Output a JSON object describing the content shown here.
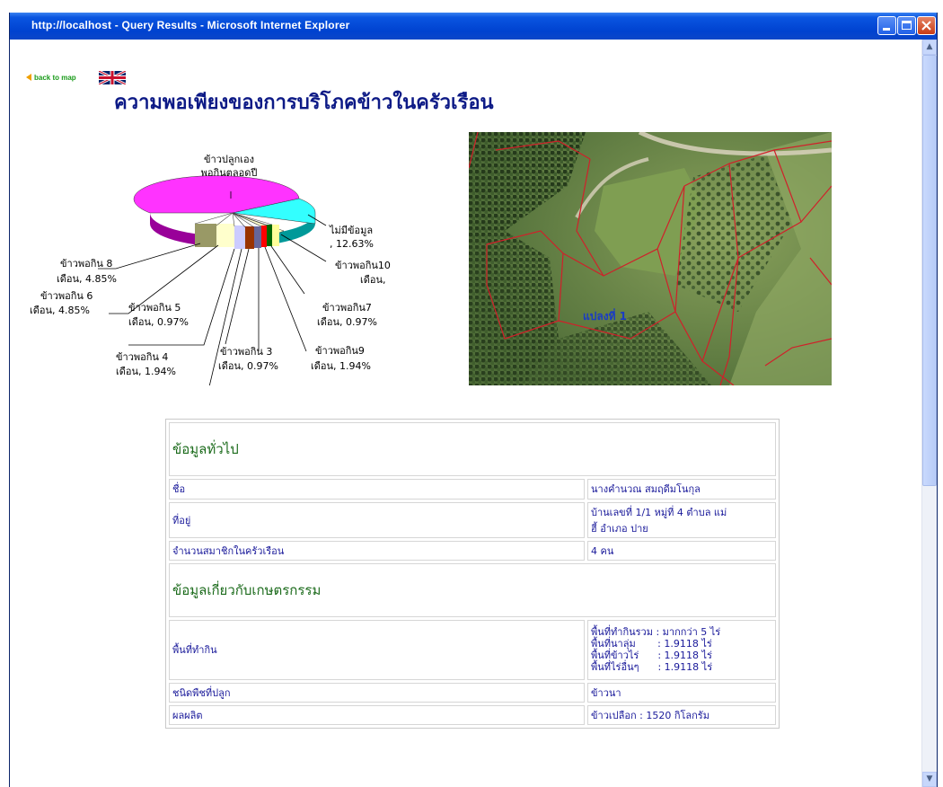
{
  "window": {
    "title": "http://localhost - Query Results - Microsoft Internet Explorer"
  },
  "nav": {
    "back_label": "back to map",
    "flag_icon": "uk-flag-icon"
  },
  "page": {
    "title": "ความพอเพียงของการบริโภคข้าวในครัวเรือน"
  },
  "chart_data": {
    "type": "pie",
    "title": "",
    "slices": [
      {
        "label": "ข้าวปลูกเองพอกินตลอดปี",
        "value": null,
        "color": "#ff33ff"
      },
      {
        "label": "ไม่มีข้อมูล",
        "value": 12.63,
        "color": "#33ffff"
      },
      {
        "label": "ข้าวพอกิน10 เดือน",
        "value": null,
        "color": "#ffffcc"
      },
      {
        "label": "ข้าวพอกิน7 เดือน",
        "value": 0.97,
        "color": "#006600"
      },
      {
        "label": "ข้าวพอกิน9 เดือน",
        "value": 1.94,
        "color": "#ff0000"
      },
      {
        "label": "ข้าวพอกิน 3 เดือน",
        "value": 0.97,
        "color": "#666699"
      },
      {
        "label": "ข้าวพอกิน 4 เดือน",
        "value": 1.94,
        "color": "#993300"
      },
      {
        "label": "ข้าวพอกิน 5 เดือน",
        "value": 0.97,
        "color": "#ff9999"
      },
      {
        "label": "ข้าวพอกิน 6 เดือน",
        "value": 4.85,
        "color": "#ccccff"
      },
      {
        "label": "ข้าวพอกิน 8 เดือน",
        "value": 4.85,
        "color": "#999966"
      }
    ],
    "labels": {
      "top_line1": "ข้าวปลูกเอง",
      "top_line2": "พอกินตลอดปี",
      "nodata_line1": "ไม่มีข้อมูล",
      "nodata_line2": ", 12.63%",
      "m10_line1": "ข้าวพอกิน10",
      "m10_line2": "เดือน,",
      "m7_line1": "ข้าวพอกิน7",
      "m7_line2": "เดือน, 0.97%",
      "m9_line1": "ข้าวพอกิน9",
      "m9_line2": "เดือน, 1.94%",
      "m3_line1": "ข้าวพอกิน 3",
      "m3_line2": "เดือน, 0.97%",
      "m4_line1": "ข้าวพอกิน 4",
      "m4_line2": "เดือน, 1.94%",
      "m5_line1": "ข้าวพอกิน 5",
      "m5_line2": "เดือน, 0.97%",
      "m6_line1": "ข้าวพอกิน 6",
      "m6_line2": "เดือน, 4.85%",
      "m8_line1": "ข้าวพอกิน 8",
      "m8_line2": "เดือน, 4.85%"
    }
  },
  "map": {
    "plot_label": "แปลงที่ 1"
  },
  "info": {
    "general_header": "ข้อมูลทั่วไป",
    "name_label": "ชื่อ",
    "name_value": "นางคำนวณ สมฤดีมโนกุล",
    "address_label": "ที่อยู่",
    "address_value": "บ้านเลขที่ 1/1 หมู่ที่ 4 ตำบล แม่\nฮี้ อำเภอ ปาย",
    "members_label": "จำนวนสมาชิกในครัวเรือน",
    "members_value": "4 คน",
    "agri_header": "ข้อมูลเกี่ยวกับเกษตรกรรม",
    "area_label": "พื้นที่ทำกิน",
    "area_total": "พื้นที่ทำกินรวม : มากกว่า 5 ไร่",
    "area_lowland": "พื้นที่นาลุ่ม       : 1.9118 ไร่",
    "area_upland": "พื้นที่ข้าวไร่      : 1.9118 ไร่",
    "area_other": "พื้นที่ไร่อื่นๆ      : 1.9118 ไร่",
    "crop_label": "ชนิดพืชที่ปลูก",
    "crop_value": "ข้าวนา",
    "yield_label": "ผลผลิต",
    "yield_value": "ข้าวเปลือก : 1520 กิโลกรัม"
  }
}
